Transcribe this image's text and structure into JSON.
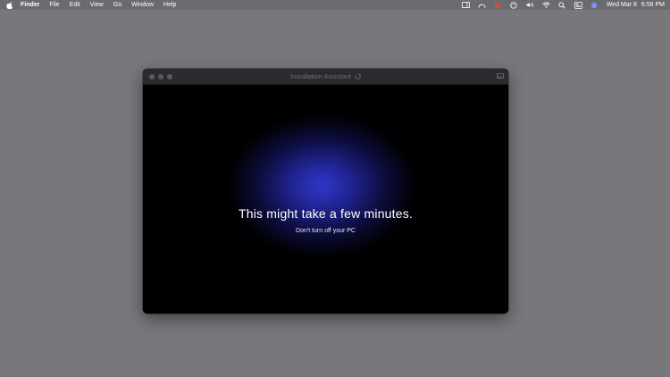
{
  "menubar": {
    "app_name": "Finder",
    "items": [
      "File",
      "Edit",
      "View",
      "Go",
      "Window",
      "Help"
    ],
    "status_icons": [
      "sidebar-icon",
      "gauge-icon",
      "x-app-icon",
      "timer-icon",
      "volume-icon",
      "wifi-icon",
      "search-icon",
      "control-center-icon",
      "siri-icon"
    ],
    "date": "Wed Mar 8",
    "time": "6:58 PM"
  },
  "window": {
    "title": "Installation Assistant",
    "headline": "This might take a few minutes.",
    "subline": "Don't turn off your PC",
    "accent_color": "#3038d8"
  }
}
